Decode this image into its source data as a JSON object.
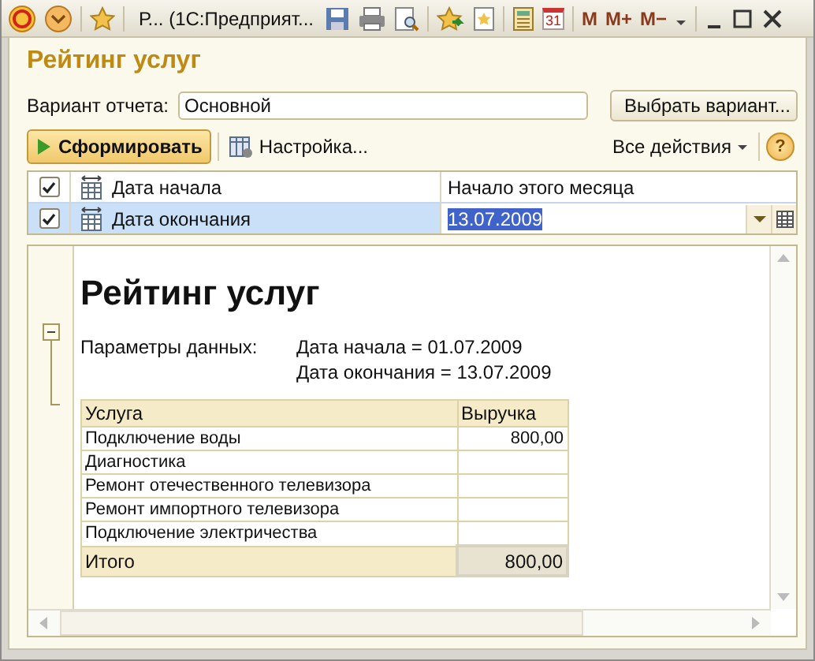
{
  "window": {
    "title": "Р...  (1С:Предприят...",
    "calendar_day": "31",
    "memory_buttons": [
      "M",
      "M+",
      "M−"
    ]
  },
  "form": {
    "title": "Рейтинг услуг",
    "variant": {
      "label": "Вариант отчета:",
      "value": "Основной"
    },
    "choose_button": "Выбрать вариант...",
    "generate_button": "Сформировать",
    "settings_button": "Настройка...",
    "all_actions": "Все действия",
    "help": "?"
  },
  "params": [
    {
      "checked": true,
      "name": "Дата начала",
      "value": "Начало этого месяца",
      "selected": false
    },
    {
      "checked": true,
      "name": "Дата окончания",
      "value": "13.07.2009",
      "selected": true
    }
  ],
  "report": {
    "title": "Рейтинг услуг",
    "params_label": "Параметры данных:",
    "params_lines": [
      "Дата начала = 01.07.2009",
      "Дата окончания = 13.07.2009"
    ],
    "columns": [
      "Услуга",
      "Выручка"
    ],
    "rows": [
      {
        "service": "Подключение воды",
        "revenue": "800,00"
      },
      {
        "service": "Диагностика",
        "revenue": ""
      },
      {
        "service": "Ремонт отечественного телевизора",
        "revenue": ""
      },
      {
        "service": "Ремонт импортного телевизора",
        "revenue": ""
      },
      {
        "service": "Подключение электричества",
        "revenue": ""
      }
    ],
    "total": {
      "label": "Итого",
      "value": "800,00"
    },
    "expanded": true
  }
}
